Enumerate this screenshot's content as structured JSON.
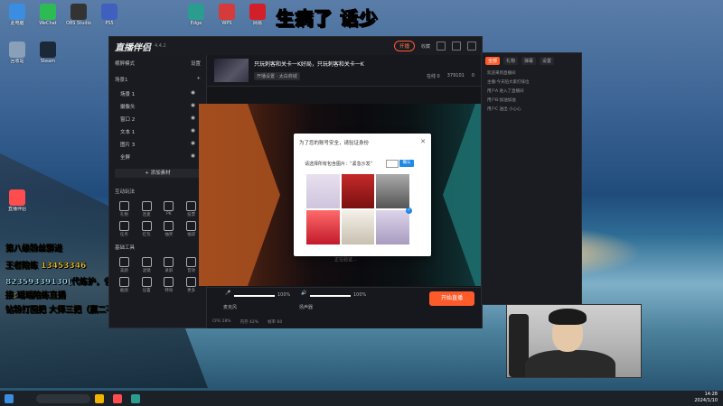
{
  "desktop_icons": [
    {
      "label": "此电脑",
      "color": "#3b8de0"
    },
    {
      "label": "WeChat",
      "color": "#2dbb54"
    },
    {
      "label": "OBS Studio",
      "color": "#333333"
    },
    {
      "label": "PS5",
      "color": "#4060c0"
    },
    {
      "label": "回收站",
      "color": "#8aa0b8"
    },
    {
      "label": "Edge",
      "color": "#2a9d8f"
    },
    {
      "label": "WPS",
      "color": "#d63b3b"
    },
    {
      "label": "网易",
      "color": "#d21f2a"
    },
    {
      "label": "Steam",
      "color": "#1b2838"
    },
    {
      "label": "直播伴侣",
      "color": "#ff4d4f"
    }
  ],
  "overlay": {
    "big_title": "生病了 话少",
    "promo_lines": [
      {
        "text": "第八级粉丝群进",
        "color": "#ffd43b"
      },
      {
        "text": "王者陪练 13453346",
        "color": "#ffd43b"
      },
      {
        "text": "82359339130(代练护，省天)",
        "color": "#a0e0ff"
      },
      {
        "text": "接:瑶瑶陪练直播",
        "color": "#ffd43b"
      },
      {
        "text": "钻粉打回把   大师三把（赢二不打三）",
        "color": "#ffd43b"
      }
    ]
  },
  "app": {
    "name": "直播伴侣",
    "version": "4.4.2",
    "start_live_label": "开播",
    "top_right_user": "收藏",
    "room": {
      "title": "只玩刺客和关卡一K好局，只玩刺客和关卡一K",
      "sub": "开播设置 · 太白商城",
      "stats": [
        "在线 0",
        "379101",
        "0"
      ]
    },
    "left": {
      "mode_label": "横屏模式",
      "mode_right": "设置",
      "scenes_header": "场景1",
      "scenes": [
        {
          "label": "场景 1"
        },
        {
          "label": "摄像头"
        },
        {
          "label": "窗口 2"
        },
        {
          "label": "文本 1"
        },
        {
          "label": "图片 3"
        },
        {
          "label": "全屏"
        }
      ],
      "add_source": "+ 添加素材",
      "interactive_header": "互动玩法",
      "tools": [
        "礼物",
        "连麦",
        "PK",
        "投票",
        "任务",
        "红包",
        "抽奖",
        "福袋"
      ],
      "basic_header": "基础工具",
      "basic_tools": [
        "美颜",
        "滤镜",
        "录屏",
        "音效",
        "截图",
        "设置",
        "特效",
        "更多"
      ]
    },
    "bottom": {
      "mic_label": "麦克风",
      "mic_pct": "100%",
      "mic_value": 1.0,
      "spk_label": "扬声器",
      "spk_pct": "100%",
      "spk_value": 1.0,
      "start_button": "开始直播",
      "status": [
        "CPU 28%",
        "内存 42%",
        "帧率 60"
      ]
    }
  },
  "captcha": {
    "title": "为了您的账号安全，请验证身份",
    "question": "请选择所有包含图片：“紧急沙发”",
    "refresh": "刷新",
    "confirm": "确认",
    "hint": "正在验证..."
  },
  "chat": {
    "tabs": [
      "全部",
      "礼物",
      "弹幕",
      "设置"
    ],
    "messages": [
      "欢迎来到直播间",
      "主播:今天陪大家打排位",
      "用户A 进入了直播间",
      "用户B:加油加油",
      "用户C 送出 小心心"
    ]
  },
  "clock": {
    "time": "14:28",
    "date": "2024/1/10"
  }
}
